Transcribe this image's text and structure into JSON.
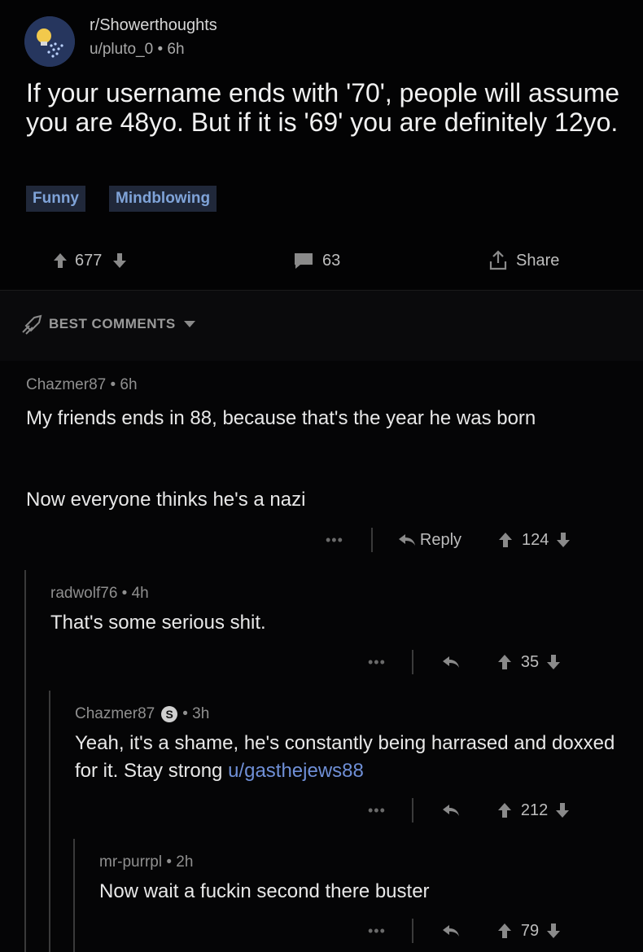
{
  "post": {
    "subreddit": "r/Showerthoughts",
    "user_line": "u/pluto_0 • 6h",
    "title": "If your username ends with '70', people will assume you are 48yo. But if it is '69' you are definitely 12yo.",
    "flairs": [
      "Funny",
      "Mindblowing"
    ],
    "votes": "677",
    "comments": "63",
    "share_label": "Share"
  },
  "sort": {
    "label": "BEST COMMENTS"
  },
  "comments": [
    {
      "author": "Chazmer87",
      "time": "• 6h",
      "body1": "My friends ends in 88, because that's the year he was born",
      "body2": "Now everyone thinks he's a nazi",
      "reply_label": "Reply",
      "votes": "124"
    },
    {
      "author": "radwolf76",
      "time": "• 4h",
      "body": "That's some serious shit.",
      "votes": "35"
    },
    {
      "author": "Chazmer87",
      "badge": "S",
      "time": "• 3h",
      "body_text": "Yeah, it's a shame, he's constantly being harrased and doxxed for it. Stay strong ",
      "body_link": "u/gasthejews88",
      "votes": "212"
    },
    {
      "author": "mr-purrpl",
      "time": "• 2h",
      "body": "Now wait a fuckin second there buster",
      "votes": "79"
    }
  ],
  "icons": {
    "upvote": "arrow-up-icon",
    "downvote": "arrow-down-icon",
    "comment": "comment-bubble-icon",
    "share": "share-icon",
    "reply": "reply-arrow-icon",
    "more": "more-dots-icon",
    "sort": "rocket-icon"
  },
  "colors": {
    "background": "#050506",
    "flair_text": "#7fa3d8",
    "link": "#6f8fd6"
  }
}
